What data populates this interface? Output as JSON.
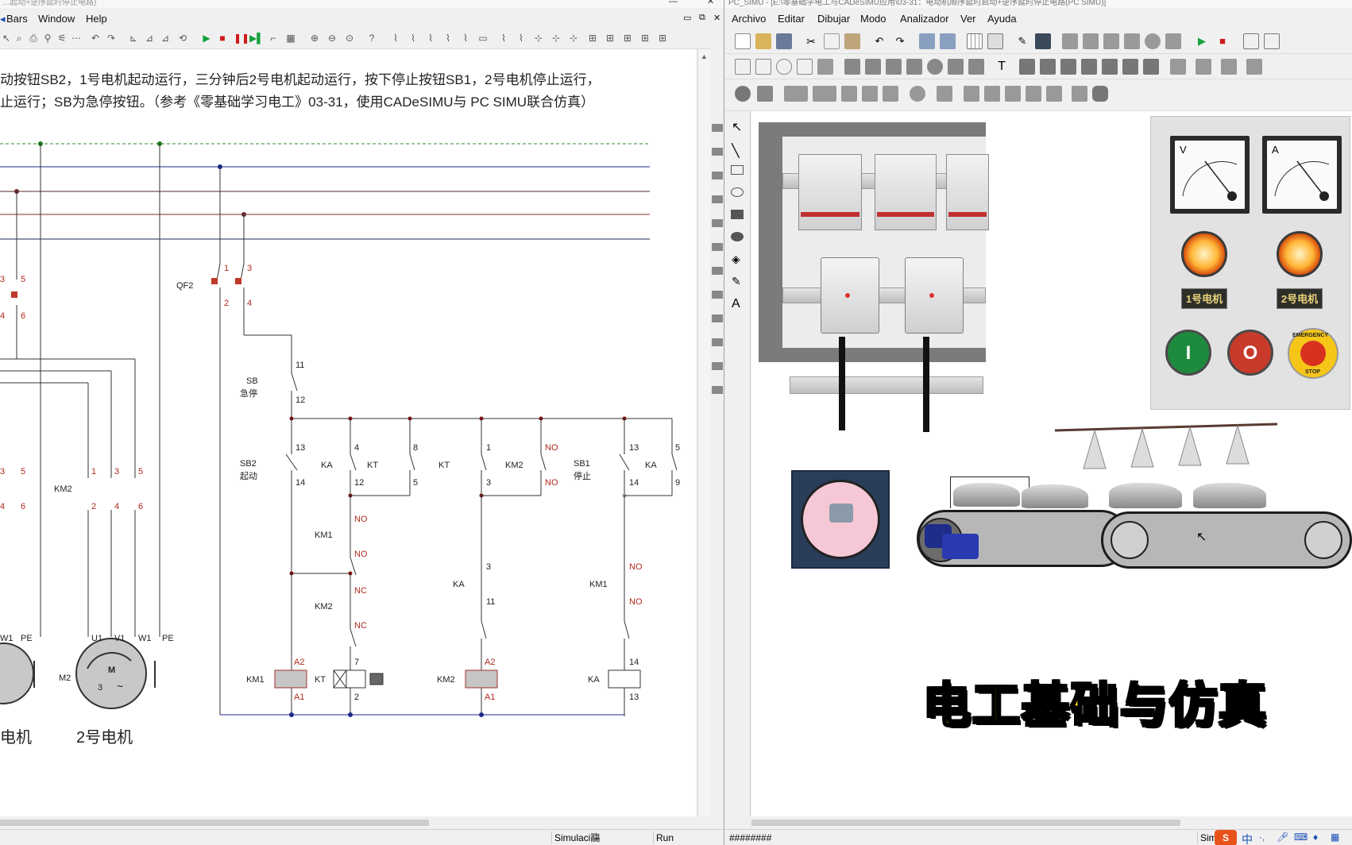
{
  "left_window": {
    "title": "...起动+逆序延时停止电路)",
    "menu": [
      "Bars",
      "Window",
      "Help"
    ],
    "description_line1": "动按钮SB2，1号电机起动运行，三分钟后2号电机起动运行，按下停止按钮SB1，2号电机停止运行，",
    "description_line2": "止运行；SB为急停按钮。（参考《零基础学习电工》03-31，使用CADeSIMU与 PC SIMU联合仿真）",
    "status": {
      "mode": "Simulaci鬺",
      "state": "Run"
    },
    "schematic": {
      "qf2": "QF2",
      "qf2_terminals": [
        "1",
        "3",
        "2",
        "4"
      ],
      "sb_label": "SB",
      "sb_sub": "急停",
      "sb_terminals": [
        "11",
        "12"
      ],
      "sb2_label": "SB2",
      "sb2_sub": "起动",
      "sb2_terminals": [
        "13",
        "14"
      ],
      "ka_label": "KA",
      "ka_terminals": [
        "4",
        "12"
      ],
      "kt_label": "KT",
      "kt_terminals": [
        "8",
        "5"
      ],
      "kt2_label": "KT",
      "kt2_terminals": [
        "1",
        "3"
      ],
      "km2_label": "KM2",
      "no": "NO",
      "sb1_label": "SB1",
      "sb1_sub": "停止",
      "sb1_terminals": [
        "13",
        "14"
      ],
      "ka2_label": "KA",
      "ka2_terminals": [
        "5",
        "9"
      ],
      "km1_label": "KM1",
      "km2_b_label": "KM2",
      "nc": "NC",
      "ka3_label": "KA",
      "ka3_terminals": [
        "3",
        "11"
      ],
      "km1_b_label": "KM1",
      "terminal_7": "7",
      "terminal_14": "14",
      "coil_km1": "KM1",
      "coil_kt": "KT",
      "coil_km2": "KM2",
      "coil_ka": "KA",
      "a2": "A2",
      "a1": "A1",
      "terminal_2": "2",
      "terminal_13": "13",
      "km2_main": "KM2",
      "main_terminals": [
        "1",
        "3",
        "5",
        "2",
        "4",
        "6"
      ],
      "left_contacts": [
        "3",
        "5",
        "4",
        "6",
        "3",
        "5",
        "4",
        "6"
      ],
      "motor_terms": [
        "U1",
        "V1",
        "W1",
        "PE"
      ],
      "motor_terms_left": [
        "W1",
        "PE"
      ],
      "motor2_id": "M2",
      "motor2_m": "M",
      "motor2_phase": "3",
      "motor2_wave": "~",
      "motor1_name": "电机",
      "motor2_name": "2号电机"
    }
  },
  "right_window": {
    "title": "PC_SIMU - [E:\\零基础学电工与CADeSIMU应用\\03-31：电动机顺序延时启动+逆序延时停止电路(PC SIMU)]",
    "menu": [
      "Archivo",
      "Editar",
      "Dibujar",
      "Modo",
      "Analizador",
      "Ver",
      "Ayuda"
    ],
    "status_left": "########",
    "status_right": "Sim",
    "panel": {
      "voltmeter": "V",
      "ammeter": "A",
      "lamp1_label": "1号电机",
      "lamp2_label": "2号电机",
      "start_button": "I",
      "stop_button": "O",
      "estop_top": "EMERGENCY",
      "estop_bottom": "STOP"
    },
    "watermark": "电工基础与仿真",
    "ime": "中"
  }
}
